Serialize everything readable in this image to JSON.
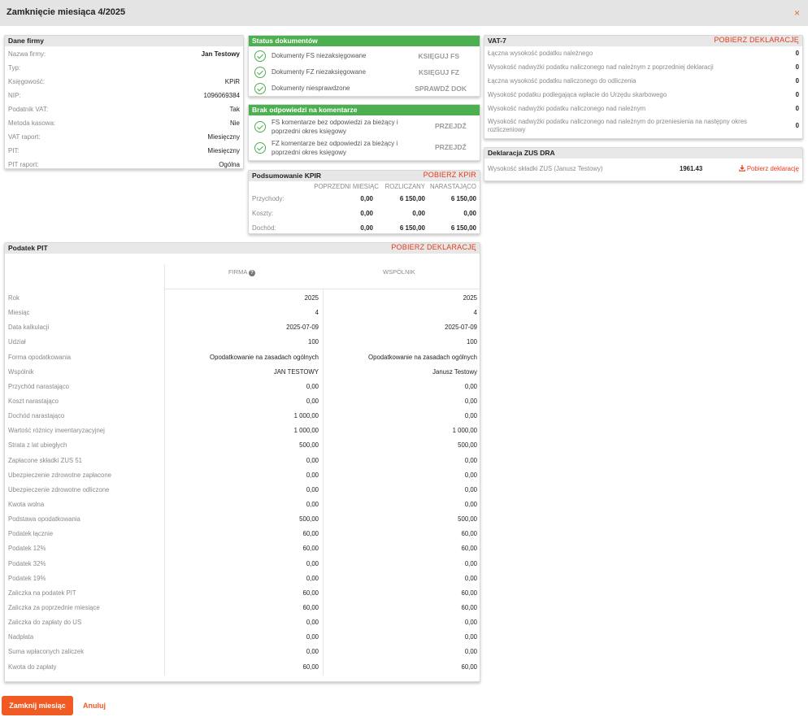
{
  "header": {
    "title": "Zamknięcie miesiąca 4/2025",
    "close_glyph": "×"
  },
  "company": {
    "title": "Dane firmy",
    "rows": [
      {
        "k": "Nazwa firmy:",
        "v": "Jan Testowy",
        "bold": true
      },
      {
        "k": "Typ:",
        "v": ""
      },
      {
        "k": "Księgowość:",
        "v": "KPiR"
      },
      {
        "k": "NIP:",
        "v": "1096069384"
      },
      {
        "k": "Podatnik VAT:",
        "v": "Tak"
      },
      {
        "k": "Metoda kasowa:",
        "v": "Nie"
      },
      {
        "k": "VAT raport:",
        "v": "Miesięczny"
      },
      {
        "k": "PIT:",
        "v": "Miesięczny"
      },
      {
        "k": "PIT raport:",
        "v": "Ogólna"
      }
    ]
  },
  "status": {
    "title": "Status dokumentów",
    "rows": [
      {
        "label": "Dokumenty FS niezaksięgowane",
        "action": "KSIĘGUJ FS"
      },
      {
        "label": "Dokumenty FZ niezaksięgowane",
        "action": "KSIĘGUJ FZ"
      },
      {
        "label": "Dokumenty niesprawdzone",
        "action": "SPRAWDŹ DOK"
      }
    ]
  },
  "comments": {
    "title": "Brak odpowiedzi na komentarze",
    "rows": [
      {
        "label": "FS komentarze bez odpowiedzi za bieżący i poprzedni okres księgowy",
        "action": "PRZEJDŹ"
      },
      {
        "label": "FZ komentarze bez odpowiedzi za bieżący i poprzedni okres księgowy",
        "action": "PRZEJDŹ"
      }
    ]
  },
  "kpir": {
    "title": "Podsumowanie KPIR",
    "action": "POBIERZ KPIR",
    "columns": [
      "POPRZEDNI MIESIĄC",
      "ROZLICZANY",
      "NARASTAJĄCO"
    ],
    "rows": [
      {
        "label": "Przychody:",
        "values": [
          "0,00",
          "6 150,00",
          "6 150,00"
        ]
      },
      {
        "label": "Koszty:",
        "values": [
          "0,00",
          "0,00",
          "0,00"
        ]
      },
      {
        "label": "Dochód:",
        "values": [
          "0,00",
          "6 150,00",
          "6 150,00"
        ]
      }
    ]
  },
  "vat": {
    "title": "VAT-7",
    "action": "POBIERZ DEKLARACJĘ",
    "rows": [
      {
        "k": "Łączna wysokość podatku należnego",
        "v": "0"
      },
      {
        "k": "Wysokość nadwyżki podatku naliczonego nad należnym z poprzedniej deklaracji",
        "v": "0"
      },
      {
        "k": "Łączna wysokość podatku naliczonego do odliczenia",
        "v": "0"
      },
      {
        "k": "Wysokość podatku podlegająca wpłacie do Urzędu skarbowego",
        "v": "0"
      },
      {
        "k": "Wysokość nadwyżki podatku naliczonego nad należnym",
        "v": "0"
      },
      {
        "k": "Wysokość nadwyżki podatku naliczonego nad należnym do przeniesienia na następny okres rozliczeniowy",
        "v": "0"
      }
    ]
  },
  "zus": {
    "title": "Deklaracja ZUS DRA",
    "label": "Wysokość składki ZUS (Janusz Testowy)",
    "value": "1961.43",
    "action": "Pobierz deklarację"
  },
  "pit": {
    "title": "Podatek PIT",
    "action": "POBIERZ DEKLARACJĘ",
    "col_firma": "FIRMA",
    "col_wspolnik": "WSPÓLNIK",
    "rows": [
      {
        "label": "Rok",
        "a": "2025",
        "b": "2025"
      },
      {
        "label": "Miesiąc",
        "a": "4",
        "b": "4"
      },
      {
        "label": "Data kalkulacji",
        "a": "2025-07-09",
        "b": "2025-07-09"
      },
      {
        "label": "Udział",
        "a": "100",
        "b": "100"
      },
      {
        "label": "Forma opodatkowania",
        "a": "Opodatkowanie na zasadach ogólnych",
        "b": "Opodatkowanie na zasadach ogólnych"
      },
      {
        "label": "Wspólnik",
        "a": "JAN TESTOWY",
        "b": "Janusz Testowy"
      },
      {
        "label": "Przychód narastająco",
        "a": "0,00",
        "b": "0,00"
      },
      {
        "label": "Koszt narastająco",
        "a": "0,00",
        "b": "0,00"
      },
      {
        "label": "Dochód narastająco",
        "a": "1 000,00",
        "b": "0,00"
      },
      {
        "label": "Wartość różnicy inwentaryzacyjnej",
        "a": "1 000,00",
        "b": "1 000,00"
      },
      {
        "label": "Strata z lat ubiegłych",
        "a": "500,00",
        "b": "500,00"
      },
      {
        "label": "Zapłacone składki ZUS 51",
        "a": "0,00",
        "b": "0,00"
      },
      {
        "label": "Ubezpieczenie zdrowotne zapłacone",
        "a": "0,00",
        "b": "0,00"
      },
      {
        "label": "Ubezpieczenie zdrowotne odliczone",
        "a": "0,00",
        "b": "0,00"
      },
      {
        "label": "Kwota wolna",
        "a": "0,00",
        "b": "0,00"
      },
      {
        "label": "Podstawa opodatkowania",
        "a": "500,00",
        "b": "500,00"
      },
      {
        "label": "Podatek łącznie",
        "a": "60,00",
        "b": "60,00"
      },
      {
        "label": "Podatek 12%",
        "a": "60,00",
        "b": "60,00"
      },
      {
        "label": "Podatek 32%",
        "a": "0,00",
        "b": "0,00"
      },
      {
        "label": "Podatek 19%",
        "a": "0,00",
        "b": "0,00"
      },
      {
        "label": "Zaliczka na podatek PIT",
        "a": "60,00",
        "b": "60,00"
      },
      {
        "label": "Zaliczka za poprzednie miesiące",
        "a": "60,00",
        "b": "60,00"
      },
      {
        "label": "Zaliczka do zapłaty do US",
        "a": "0,00",
        "b": "0,00"
      },
      {
        "label": "Nadpłata",
        "a": "0,00",
        "b": "0,00"
      },
      {
        "label": "Suma wpłaconych zaliczek",
        "a": "0,00",
        "b": "0,00"
      },
      {
        "label": "Kwota do zapłaty",
        "a": "60,00",
        "b": "60,00"
      }
    ]
  },
  "footer": {
    "primary": "Zamknij miesiąc",
    "cancel": "Anuluj"
  },
  "colors": {
    "accent": "#f15a22",
    "success": "#4caf50",
    "action_red": "#e53a1c"
  }
}
